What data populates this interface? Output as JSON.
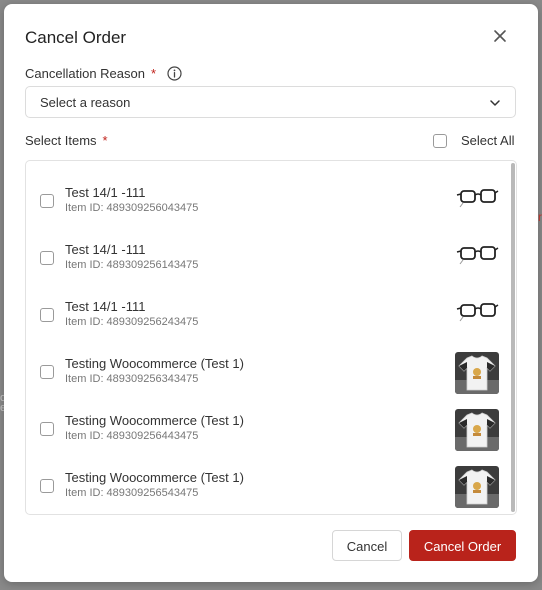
{
  "background": {
    "peek_left_1": "o",
    "peek_left_2": "e",
    "peek_right": "r"
  },
  "modal": {
    "title": "Cancel Order",
    "close_icon": "close-icon"
  },
  "reason": {
    "label": "Cancellation Reason",
    "required_mark": "*",
    "info_icon": "info-icon",
    "selected_value": "Select a reason",
    "chevron_icon": "chevron-down-icon"
  },
  "items_section": {
    "label": "Select Items",
    "required_mark": "*",
    "select_all_label": "Select All",
    "items": [
      {
        "title": "Test 14/1 -111",
        "item_id": "Item ID: 489309256043475",
        "thumb": "glasses"
      },
      {
        "title": "Test 14/1 -111",
        "item_id": "Item ID: 489309256143475",
        "thumb": "glasses"
      },
      {
        "title": "Test 14/1 -111",
        "item_id": "Item ID: 489309256243475",
        "thumb": "glasses"
      },
      {
        "title": "Testing Woocommerce (Test 1)",
        "item_id": "Item ID: 489309256343475",
        "thumb": "tshirt"
      },
      {
        "title": "Testing Woocommerce (Test 1)",
        "item_id": "Item ID: 489309256443475",
        "thumb": "tshirt"
      },
      {
        "title": "Testing Woocommerce (Test 1)",
        "item_id": "Item ID: 489309256543475",
        "thumb": "tshirt"
      }
    ]
  },
  "footer": {
    "cancel_label": "Cancel",
    "confirm_label": "Cancel Order"
  },
  "colors": {
    "primary": "#b9231b",
    "required": "#c0211a",
    "overlay": "#8a8a8a"
  }
}
